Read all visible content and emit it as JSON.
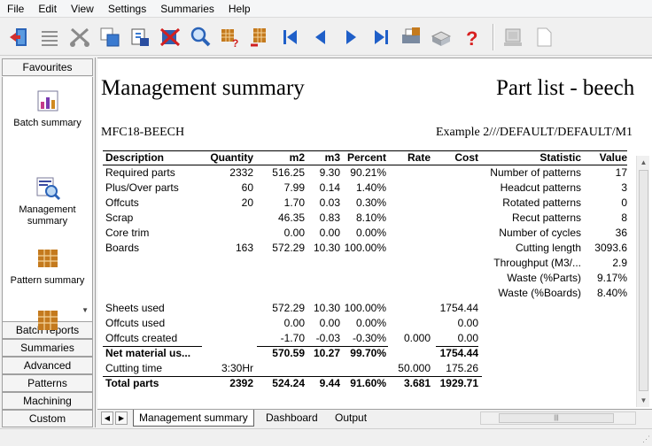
{
  "menu": [
    "File",
    "Edit",
    "View",
    "Settings",
    "Summaries",
    "Help"
  ],
  "toolbar": {
    "icons": [
      "exit-icon",
      "list-icon",
      "cut-icon",
      "copy-icon",
      "paste-icon",
      "delete-icon",
      "find-icon",
      "edit-pattern-icon",
      "replace-icon",
      "first-icon",
      "previous-icon",
      "next-icon",
      "last-icon",
      "print-preview-icon",
      "print-icon",
      "help-icon",
      "machine-icon",
      "page-icon"
    ]
  },
  "sidebar": {
    "favourites_label": "Favourites",
    "items": [
      {
        "label": "Batch summary"
      },
      {
        "label": "Management summary"
      },
      {
        "label": "Pattern summary"
      }
    ],
    "groups": [
      "Batch reports",
      "Summaries",
      "Advanced",
      "Patterns",
      "Machining",
      "Custom"
    ]
  },
  "report": {
    "title": "Management summary",
    "title_right": "Part list - beech",
    "job": "MFC18-BEECH",
    "path": "Example 2///DEFAULT/DEFAULT/M1",
    "headers": {
      "description": "Description",
      "quantity": "Quantity",
      "m2": "m2",
      "m3": "m3",
      "percent": "Percent",
      "rate": "Rate",
      "cost": "Cost",
      "statistic": "Statistic",
      "value": "Value"
    },
    "rows": [
      {
        "description": "Required parts",
        "quantity": "2332",
        "m2": "516.25",
        "m3": "9.30",
        "percent": "90.21%",
        "rate": "",
        "cost": "",
        "statistic": "Number of patterns",
        "value": "17"
      },
      {
        "description": "Plus/Over parts",
        "quantity": "60",
        "m2": "7.99",
        "m3": "0.14",
        "percent": "1.40%",
        "rate": "",
        "cost": "",
        "statistic": "Headcut patterns",
        "value": "3"
      },
      {
        "description": "Offcuts",
        "quantity": "20",
        "m2": "1.70",
        "m3": "0.03",
        "percent": "0.30%",
        "rate": "",
        "cost": "",
        "statistic": "Rotated patterns",
        "value": "0"
      },
      {
        "description": "Scrap",
        "quantity": "",
        "m2": "46.35",
        "m3": "0.83",
        "percent": "8.10%",
        "rate": "",
        "cost": "",
        "statistic": "Recut patterns",
        "value": "8"
      },
      {
        "description": "Core trim",
        "quantity": "",
        "m2": "0.00",
        "m3": "0.00",
        "percent": "0.00%",
        "rate": "",
        "cost": "",
        "statistic": "Number of cycles",
        "value": "36"
      },
      {
        "description": "Boards",
        "quantity": "163",
        "m2": "572.29",
        "m3": "10.30",
        "percent": "100.00%",
        "rate": "",
        "cost": "",
        "statistic": "Cutting length",
        "value": "3093.6"
      },
      {
        "description": "",
        "quantity": "",
        "m2": "",
        "m3": "",
        "percent": "",
        "rate": "",
        "cost": "",
        "statistic": "Throughput (M3/...",
        "value": "2.9"
      },
      {
        "description": "",
        "quantity": "",
        "m2": "",
        "m3": "",
        "percent": "",
        "rate": "",
        "cost": "",
        "statistic": "Waste (%Parts)",
        "value": "9.17%"
      },
      {
        "description": "",
        "quantity": "",
        "m2": "",
        "m3": "",
        "percent": "",
        "rate": "",
        "cost": "",
        "statistic": "Waste (%Boards)",
        "value": "8.40%"
      },
      {
        "description": "Sheets used",
        "quantity": "",
        "m2": "572.29",
        "m3": "10.30",
        "percent": "100.00%",
        "rate": "",
        "cost": "1754.44",
        "statistic": "",
        "value": ""
      },
      {
        "description": "Offcuts used",
        "quantity": "",
        "m2": "0.00",
        "m3": "0.00",
        "percent": "0.00%",
        "rate": "",
        "cost": "0.00",
        "statistic": "",
        "value": ""
      },
      {
        "description": "Offcuts created",
        "quantity": "",
        "m2": "-1.70",
        "m3": "-0.03",
        "percent": "-0.30%",
        "rate": "0.000",
        "cost": "0.00",
        "statistic": "",
        "value": ""
      },
      {
        "description": "Net material us...",
        "quantity": "",
        "m2": "570.59",
        "m3": "10.27",
        "percent": "99.70%",
        "rate": "",
        "cost": "1754.44",
        "statistic": "",
        "value": "",
        "bold": true
      },
      {
        "description": "Cutting time",
        "quantity": "3:30Hr",
        "m2": "",
        "m3": "",
        "percent": "",
        "rate": "50.000",
        "cost": "175.26",
        "statistic": "",
        "value": ""
      },
      {
        "description": "Total parts",
        "quantity": "2392",
        "m2": "524.24",
        "m3": "9.44",
        "percent": "91.60%",
        "rate": "3.681",
        "cost": "1929.71",
        "statistic": "",
        "value": "",
        "bold": true
      }
    ]
  },
  "tabs": [
    {
      "label": "Management summary",
      "active": true
    },
    {
      "label": "Dashboard",
      "active": false
    },
    {
      "label": "Output",
      "active": false
    }
  ]
}
